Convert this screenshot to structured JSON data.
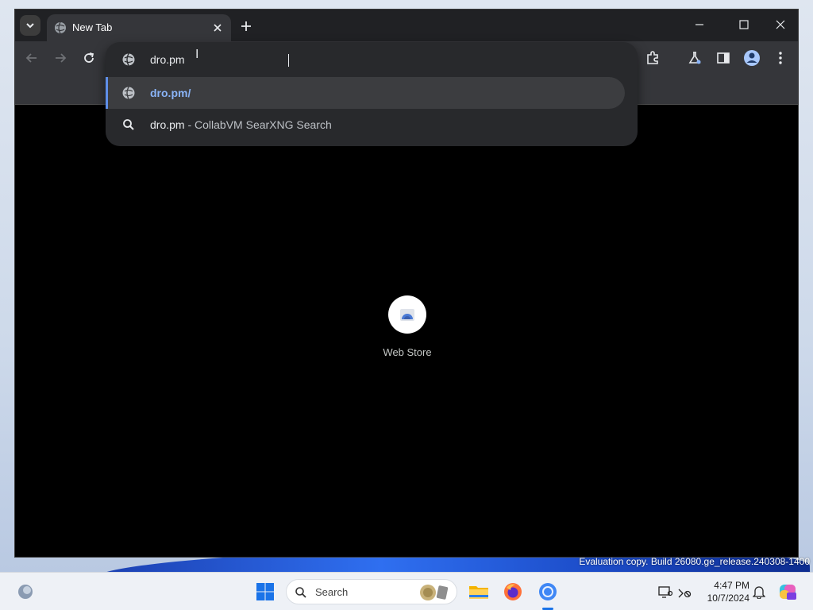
{
  "window": {
    "tab_title": "New Tab"
  },
  "omnibox": {
    "input_value": "dro.pm",
    "suggestions": [
      {
        "text": "dro.pm/",
        "subtext": ""
      },
      {
        "text": "dro.pm",
        "subtext": "- CollabVM SearXNG Search"
      }
    ]
  },
  "ntp": {
    "shortcut_label": "Web Store"
  },
  "desktop": {
    "watermark_line1": "Evaluation copy. Build 26080.ge_release.240308-1400"
  },
  "taskbar": {
    "search_label": "Search",
    "time": "4:47 PM",
    "date": "10/7/2024"
  },
  "colors": {
    "accent": "#8ab4f8",
    "selection_bar": "#5f8fe8",
    "taskbar_active": "#1a73e8"
  }
}
